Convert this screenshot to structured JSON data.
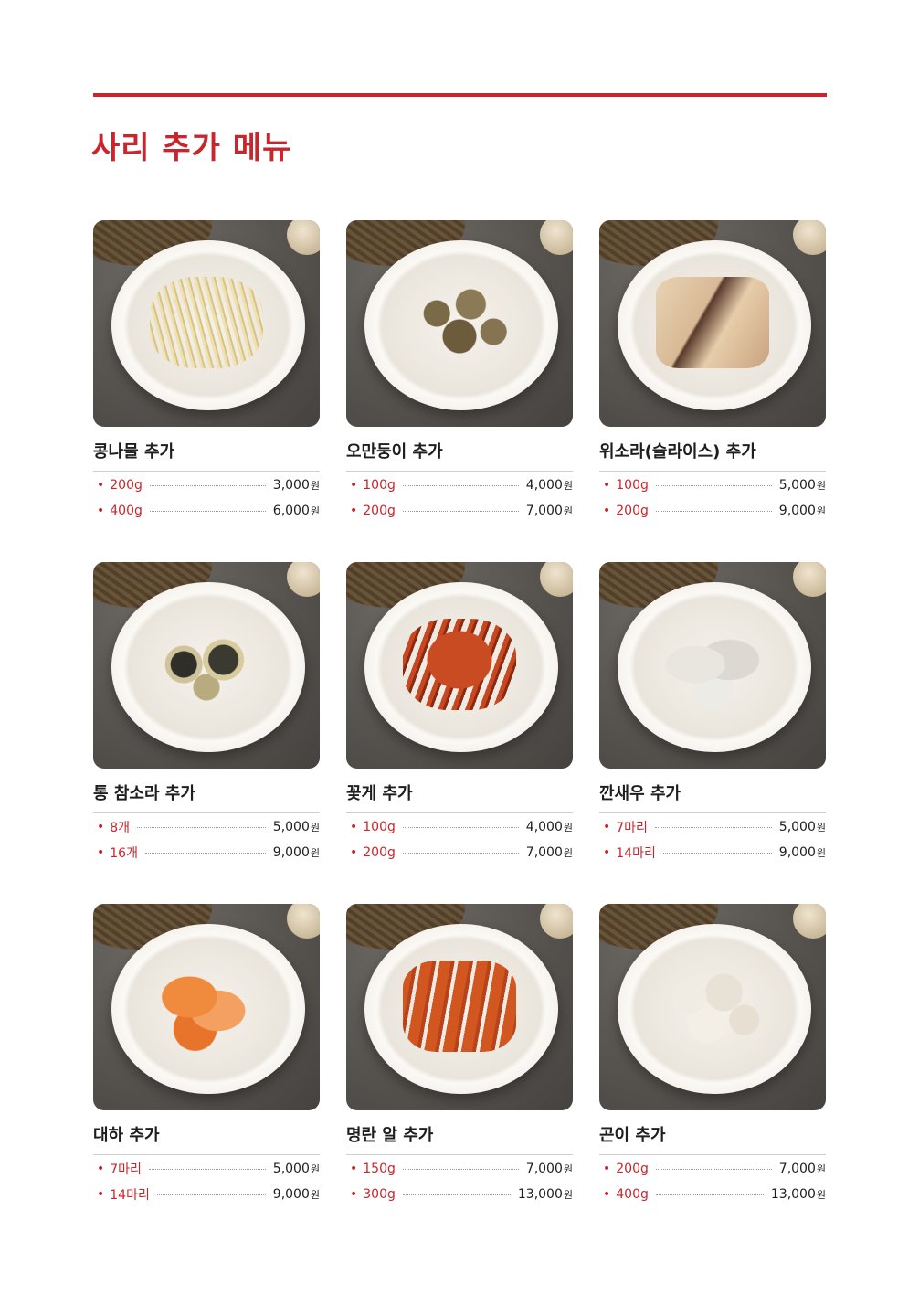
{
  "header": {
    "title": "사리 추가 메뉴"
  },
  "items": [
    {
      "name": "콩나물 추가",
      "photo": "bean-sprouts-plate",
      "prices": [
        {
          "qty": "200g",
          "price": "3,000",
          "unit": "원"
        },
        {
          "qty": "400g",
          "price": "6,000",
          "unit": "원"
        }
      ]
    },
    {
      "name": "오만둥이 추가",
      "photo": "sea-squirt-plate",
      "prices": [
        {
          "qty": "100g",
          "price": "4,000",
          "unit": "원"
        },
        {
          "qty": "200g",
          "price": "7,000",
          "unit": "원"
        }
      ]
    },
    {
      "name": "위소라(슬라이스) 추가",
      "photo": "sliced-whelk-plate",
      "prices": [
        {
          "qty": "100g",
          "price": "5,000",
          "unit": "원"
        },
        {
          "qty": "200g",
          "price": "9,000",
          "unit": "원"
        }
      ]
    },
    {
      "name": "통 참소라 추가",
      "photo": "whole-conch-plate",
      "prices": [
        {
          "qty": "8개",
          "price": "5,000",
          "unit": "원"
        },
        {
          "qty": "16개",
          "price": "9,000",
          "unit": "원"
        }
      ]
    },
    {
      "name": "꽃게 추가",
      "photo": "blue-crab-plate",
      "prices": [
        {
          "qty": "100g",
          "price": "4,000",
          "unit": "원"
        },
        {
          "qty": "200g",
          "price": "7,000",
          "unit": "원"
        }
      ]
    },
    {
      "name": "깐새우 추가",
      "photo": "peeled-shrimp-plate",
      "prices": [
        {
          "qty": "7마리",
          "price": "5,000",
          "unit": "원"
        },
        {
          "qty": "14마리",
          "price": "9,000",
          "unit": "원"
        }
      ]
    },
    {
      "name": "대하 추가",
      "photo": "king-prawn-plate",
      "prices": [
        {
          "qty": "7마리",
          "price": "5,000",
          "unit": "원"
        },
        {
          "qty": "14마리",
          "price": "9,000",
          "unit": "원"
        }
      ]
    },
    {
      "name": "명란 알 추가",
      "photo": "pollock-roe-plate",
      "prices": [
        {
          "qty": "150g",
          "price": "7,000",
          "unit": "원"
        },
        {
          "qty": "300g",
          "price": "13,000",
          "unit": "원"
        }
      ]
    },
    {
      "name": "곤이 추가",
      "photo": "cod-milt-plate",
      "prices": [
        {
          "qty": "200g",
          "price": "7,000",
          "unit": "원"
        },
        {
          "qty": "400g",
          "price": "13,000",
          "unit": "원"
        }
      ]
    }
  ]
}
